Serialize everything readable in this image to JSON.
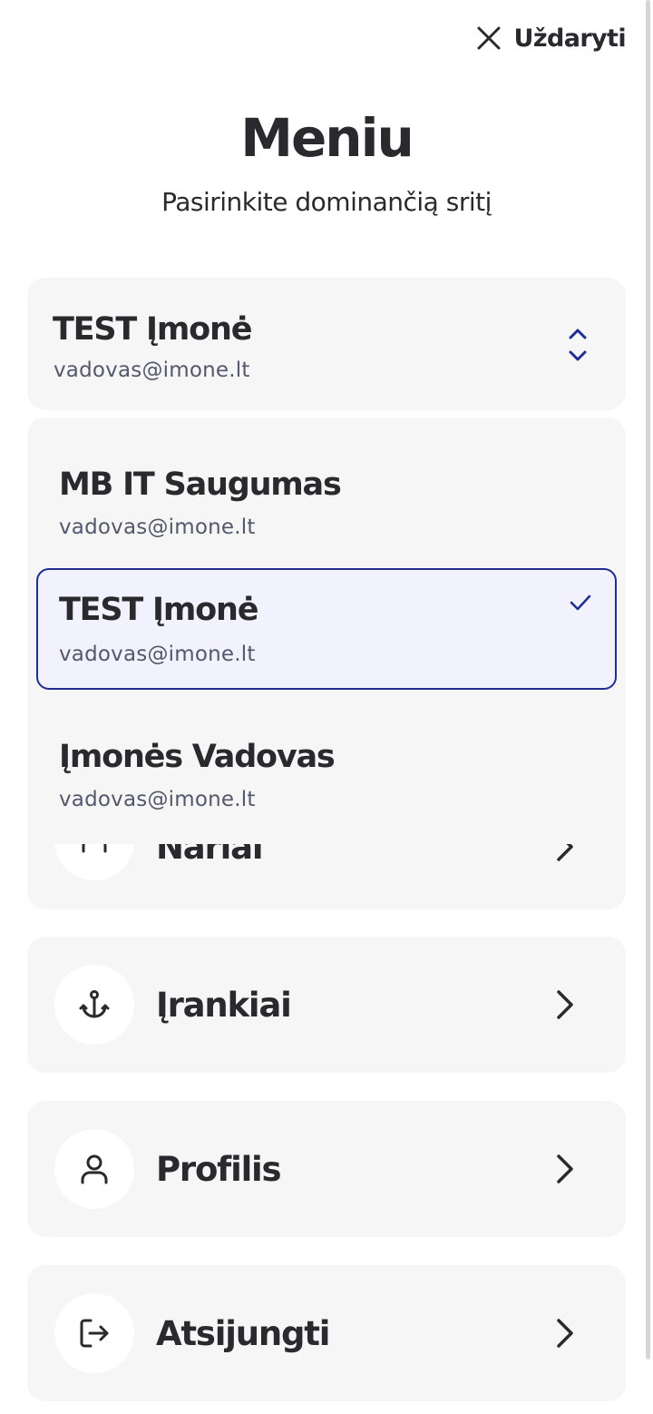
{
  "header": {
    "close_label": "Uždaryti",
    "title": "Meniu",
    "subtitle": "Pasirinkite dominančią sritį"
  },
  "company_selector": {
    "name": "TEST Įmonė",
    "email": "vadovas@imone.lt",
    "options": [
      {
        "name": "MB IT Saugumas",
        "email": "vadovas@imone.lt",
        "selected": false
      },
      {
        "name": "TEST Įmonė",
        "email": "vadovas@imone.lt",
        "selected": true
      },
      {
        "name": "Įmonės Vadovas",
        "email": "vadovas@imone.lt",
        "selected": false
      }
    ]
  },
  "menu": {
    "items": [
      {
        "label": "Nariai",
        "icon": "users-icon"
      },
      {
        "label": "Įrankiai",
        "icon": "anchor-icon"
      },
      {
        "label": "Profilis",
        "icon": "user-icon"
      },
      {
        "label": "Atsijungti",
        "icon": "logout-icon"
      }
    ]
  },
  "colors": {
    "accent": "#1f2e8f",
    "card_background": "#f6f6f7",
    "selected_background": "#f1f2fd",
    "text": "#2a2a2e",
    "muted_text": "#54586a"
  }
}
